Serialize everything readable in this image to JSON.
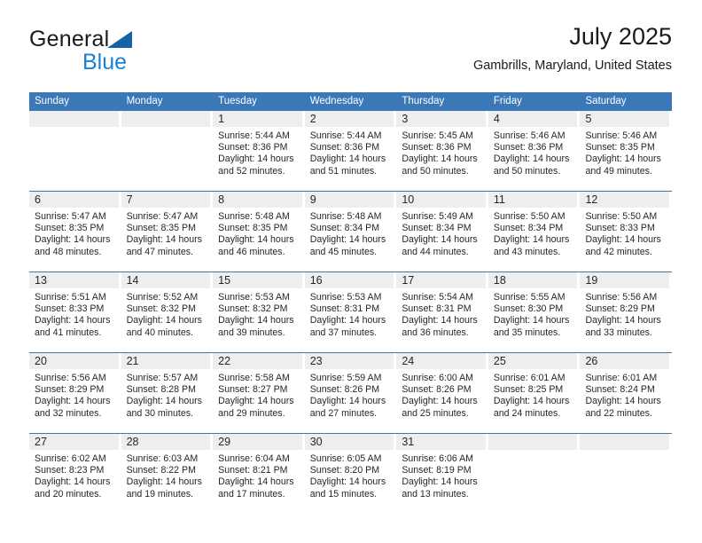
{
  "branding": {
    "logo_primary": "General",
    "logo_secondary": "Blue",
    "logo_mark": "blue-triangle-icon"
  },
  "header": {
    "title": "July 2025",
    "subtitle": "Gambrills, Maryland, United States"
  },
  "colors": {
    "header_blue": "#3b78b8",
    "logo_blue": "#1b7fd4",
    "day_band_gray": "#eeeeee",
    "text": "#262626"
  },
  "weekdays": [
    "Sunday",
    "Monday",
    "Tuesday",
    "Wednesday",
    "Thursday",
    "Friday",
    "Saturday"
  ],
  "weeks": [
    [
      {
        "day": "",
        "empty": true
      },
      {
        "day": "",
        "empty": true
      },
      {
        "day": "1",
        "sunrise": "Sunrise: 5:44 AM",
        "sunset": "Sunset: 8:36 PM",
        "daylight1": "Daylight: 14 hours",
        "daylight2": "and 52 minutes."
      },
      {
        "day": "2",
        "sunrise": "Sunrise: 5:44 AM",
        "sunset": "Sunset: 8:36 PM",
        "daylight1": "Daylight: 14 hours",
        "daylight2": "and 51 minutes."
      },
      {
        "day": "3",
        "sunrise": "Sunrise: 5:45 AM",
        "sunset": "Sunset: 8:36 PM",
        "daylight1": "Daylight: 14 hours",
        "daylight2": "and 50 minutes."
      },
      {
        "day": "4",
        "sunrise": "Sunrise: 5:46 AM",
        "sunset": "Sunset: 8:36 PM",
        "daylight1": "Daylight: 14 hours",
        "daylight2": "and 50 minutes."
      },
      {
        "day": "5",
        "sunrise": "Sunrise: 5:46 AM",
        "sunset": "Sunset: 8:35 PM",
        "daylight1": "Daylight: 14 hours",
        "daylight2": "and 49 minutes."
      }
    ],
    [
      {
        "day": "6",
        "sunrise": "Sunrise: 5:47 AM",
        "sunset": "Sunset: 8:35 PM",
        "daylight1": "Daylight: 14 hours",
        "daylight2": "and 48 minutes."
      },
      {
        "day": "7",
        "sunrise": "Sunrise: 5:47 AM",
        "sunset": "Sunset: 8:35 PM",
        "daylight1": "Daylight: 14 hours",
        "daylight2": "and 47 minutes."
      },
      {
        "day": "8",
        "sunrise": "Sunrise: 5:48 AM",
        "sunset": "Sunset: 8:35 PM",
        "daylight1": "Daylight: 14 hours",
        "daylight2": "and 46 minutes."
      },
      {
        "day": "9",
        "sunrise": "Sunrise: 5:48 AM",
        "sunset": "Sunset: 8:34 PM",
        "daylight1": "Daylight: 14 hours",
        "daylight2": "and 45 minutes."
      },
      {
        "day": "10",
        "sunrise": "Sunrise: 5:49 AM",
        "sunset": "Sunset: 8:34 PM",
        "daylight1": "Daylight: 14 hours",
        "daylight2": "and 44 minutes."
      },
      {
        "day": "11",
        "sunrise": "Sunrise: 5:50 AM",
        "sunset": "Sunset: 8:34 PM",
        "daylight1": "Daylight: 14 hours",
        "daylight2": "and 43 minutes."
      },
      {
        "day": "12",
        "sunrise": "Sunrise: 5:50 AM",
        "sunset": "Sunset: 8:33 PM",
        "daylight1": "Daylight: 14 hours",
        "daylight2": "and 42 minutes."
      }
    ],
    [
      {
        "day": "13",
        "sunrise": "Sunrise: 5:51 AM",
        "sunset": "Sunset: 8:33 PM",
        "daylight1": "Daylight: 14 hours",
        "daylight2": "and 41 minutes."
      },
      {
        "day": "14",
        "sunrise": "Sunrise: 5:52 AM",
        "sunset": "Sunset: 8:32 PM",
        "daylight1": "Daylight: 14 hours",
        "daylight2": "and 40 minutes."
      },
      {
        "day": "15",
        "sunrise": "Sunrise: 5:53 AM",
        "sunset": "Sunset: 8:32 PM",
        "daylight1": "Daylight: 14 hours",
        "daylight2": "and 39 minutes."
      },
      {
        "day": "16",
        "sunrise": "Sunrise: 5:53 AM",
        "sunset": "Sunset: 8:31 PM",
        "daylight1": "Daylight: 14 hours",
        "daylight2": "and 37 minutes."
      },
      {
        "day": "17",
        "sunrise": "Sunrise: 5:54 AM",
        "sunset": "Sunset: 8:31 PM",
        "daylight1": "Daylight: 14 hours",
        "daylight2": "and 36 minutes."
      },
      {
        "day": "18",
        "sunrise": "Sunrise: 5:55 AM",
        "sunset": "Sunset: 8:30 PM",
        "daylight1": "Daylight: 14 hours",
        "daylight2": "and 35 minutes."
      },
      {
        "day": "19",
        "sunrise": "Sunrise: 5:56 AM",
        "sunset": "Sunset: 8:29 PM",
        "daylight1": "Daylight: 14 hours",
        "daylight2": "and 33 minutes."
      }
    ],
    [
      {
        "day": "20",
        "sunrise": "Sunrise: 5:56 AM",
        "sunset": "Sunset: 8:29 PM",
        "daylight1": "Daylight: 14 hours",
        "daylight2": "and 32 minutes."
      },
      {
        "day": "21",
        "sunrise": "Sunrise: 5:57 AM",
        "sunset": "Sunset: 8:28 PM",
        "daylight1": "Daylight: 14 hours",
        "daylight2": "and 30 minutes."
      },
      {
        "day": "22",
        "sunrise": "Sunrise: 5:58 AM",
        "sunset": "Sunset: 8:27 PM",
        "daylight1": "Daylight: 14 hours",
        "daylight2": "and 29 minutes."
      },
      {
        "day": "23",
        "sunrise": "Sunrise: 5:59 AM",
        "sunset": "Sunset: 8:26 PM",
        "daylight1": "Daylight: 14 hours",
        "daylight2": "and 27 minutes."
      },
      {
        "day": "24",
        "sunrise": "Sunrise: 6:00 AM",
        "sunset": "Sunset: 8:26 PM",
        "daylight1": "Daylight: 14 hours",
        "daylight2": "and 25 minutes."
      },
      {
        "day": "25",
        "sunrise": "Sunrise: 6:01 AM",
        "sunset": "Sunset: 8:25 PM",
        "daylight1": "Daylight: 14 hours",
        "daylight2": "and 24 minutes."
      },
      {
        "day": "26",
        "sunrise": "Sunrise: 6:01 AM",
        "sunset": "Sunset: 8:24 PM",
        "daylight1": "Daylight: 14 hours",
        "daylight2": "and 22 minutes."
      }
    ],
    [
      {
        "day": "27",
        "sunrise": "Sunrise: 6:02 AM",
        "sunset": "Sunset: 8:23 PM",
        "daylight1": "Daylight: 14 hours",
        "daylight2": "and 20 minutes."
      },
      {
        "day": "28",
        "sunrise": "Sunrise: 6:03 AM",
        "sunset": "Sunset: 8:22 PM",
        "daylight1": "Daylight: 14 hours",
        "daylight2": "and 19 minutes."
      },
      {
        "day": "29",
        "sunrise": "Sunrise: 6:04 AM",
        "sunset": "Sunset: 8:21 PM",
        "daylight1": "Daylight: 14 hours",
        "daylight2": "and 17 minutes."
      },
      {
        "day": "30",
        "sunrise": "Sunrise: 6:05 AM",
        "sunset": "Sunset: 8:20 PM",
        "daylight1": "Daylight: 14 hours",
        "daylight2": "and 15 minutes."
      },
      {
        "day": "31",
        "sunrise": "Sunrise: 6:06 AM",
        "sunset": "Sunset: 8:19 PM",
        "daylight1": "Daylight: 14 hours",
        "daylight2": "and 13 minutes."
      },
      {
        "day": "",
        "empty": true
      },
      {
        "day": "",
        "empty": true
      }
    ]
  ]
}
